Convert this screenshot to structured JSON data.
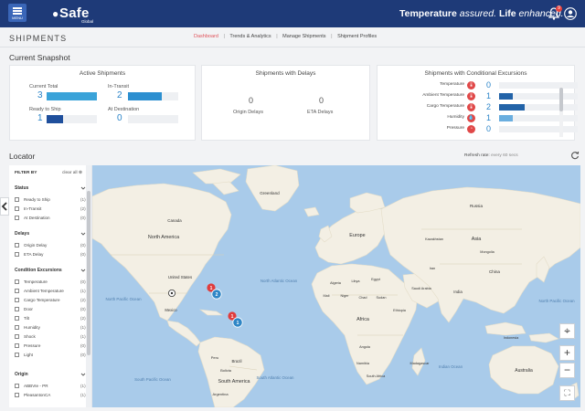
{
  "header": {
    "menu_label": "MENU",
    "logo_text": "Safe",
    "logo_sub": "Global",
    "tagline_strong_1": "Temperature",
    "tagline_italic_1": "assured.",
    "tagline_strong_2": "Life",
    "tagline_italic_2": "enhanced.",
    "notification_count": "9",
    "icons": [
      "menu-icon",
      "bell-icon",
      "user-icon"
    ]
  },
  "page": {
    "title": "SHIPMENTS",
    "nav": [
      "Dashboard",
      "Trends & Analytics",
      "Manage Shipments",
      "Shipment Profiles"
    ],
    "nav_active": "Dashboard"
  },
  "snapshot": {
    "title": "Current Snapshot",
    "active": {
      "title": "Active Shipments",
      "tiles": [
        {
          "label": "Current Total",
          "value": "3",
          "fill": 1.0,
          "color": "#3aa3d9"
        },
        {
          "label": "In-Transit",
          "value": "2",
          "fill": 0.67,
          "color": "#2c8fd0"
        },
        {
          "label": "Ready to Ship",
          "value": "1",
          "fill": 0.33,
          "color": "#1f4f9c"
        },
        {
          "label": "At Destination",
          "value": "0",
          "fill": 0.0,
          "color": "#2c8fd0"
        }
      ]
    },
    "delays": {
      "title": "Shipments with Delays",
      "items": [
        {
          "label": "Origin Delays",
          "value": "0"
        },
        {
          "label": "ETA Delays",
          "value": "0"
        }
      ]
    },
    "excursions": {
      "title": "Shipments with Conditional Excursions",
      "rows": [
        {
          "label": "Temperature",
          "value": "0",
          "icon": "thermometer-icon",
          "fill": 0.0,
          "color": "#2c8fd0"
        },
        {
          "label": "Ambient Temperature",
          "value": "1",
          "icon": "thermometer-icon",
          "fill": 0.17,
          "color": "#2263a8"
        },
        {
          "label": "Cargo Temperature",
          "value": "2",
          "icon": "thermometer-icon",
          "fill": 0.33,
          "color": "#2263a8"
        },
        {
          "label": "Humidity",
          "value": "1",
          "icon": "droplet-icon",
          "fill": 0.17,
          "color": "#6aaedf"
        },
        {
          "label": "Pressure",
          "value": "0",
          "icon": "gauge-icon",
          "fill": 0.0,
          "color": "#2c8fd0"
        }
      ]
    }
  },
  "locator": {
    "title": "Locator",
    "refresh_label": "Refresh rate:",
    "refresh_value": "every 60 secs",
    "filter": {
      "title": "FILTER BY",
      "clear_label": "clear all",
      "groups": [
        {
          "title": "Status",
          "options": [
            {
              "label": "Ready to Ship",
              "count": "(1)"
            },
            {
              "label": "In-Transit",
              "count": "(2)"
            },
            {
              "label": "At Destination",
              "count": "(0)"
            }
          ]
        },
        {
          "title": "Delays",
          "options": [
            {
              "label": "Origin Delay",
              "count": "(0)"
            },
            {
              "label": "ETA Delay",
              "count": "(0)"
            }
          ]
        },
        {
          "title": "Condition Excursions",
          "options": [
            {
              "label": "Temperature",
              "count": "(0)"
            },
            {
              "label": "Ambient Temperature",
              "count": "(1)"
            },
            {
              "label": "Cargo Temperature",
              "count": "(2)"
            },
            {
              "label": "Door",
              "count": "(0)"
            },
            {
              "label": "Tilt",
              "count": "(2)"
            },
            {
              "label": "Humidity",
              "count": "(1)"
            },
            {
              "label": "Shock",
              "count": "(1)"
            },
            {
              "label": "Pressure",
              "count": "(0)"
            },
            {
              "label": "Light",
              "count": "(0)"
            }
          ]
        },
        {
          "title": "Origin",
          "options": [
            {
              "label": "ABBVIe - PR",
              "count": "(1)"
            },
            {
              "label": "PleasantonCA",
              "count": "(1)"
            }
          ]
        }
      ]
    },
    "map": {
      "labels": {
        "greenland": "Greenland",
        "north_america": "North America",
        "south_america": "South America",
        "europe": "Europe",
        "africa": "Africa",
        "asia": "Asia",
        "australia": "Australia",
        "n_pacific": "North Pacific Ocean",
        "n_pacific_right": "North Pacific Ocean",
        "n_atlantic": "North Atlantic Ocean",
        "s_atlantic": "South Atlantic Ocean",
        "s_pacific": "South Pacific Ocean",
        "indian": "Indian Ocean",
        "united_states": "United States",
        "brazil": "Brazil",
        "russia": "Russia",
        "china": "China",
        "india": "India",
        "mexico": "Mexico",
        "canada": "Canada",
        "algeria": "Algeria",
        "libya": "Libya",
        "egypt": "Egypt",
        "chad": "Chad",
        "sudan": "Sudan",
        "niger": "Niger",
        "mali": "Mali",
        "saudi": "Saudi Arabia",
        "iran": "Iran",
        "ethiopia": "Ethiopia",
        "kazakhstan": "Kazakhstan",
        "mongolia": "Mongolia",
        "angola": "Angola",
        "peru": "Peru",
        "bolivia": "Bolivia",
        "argentina": "Argentina",
        "indonesia": "Indonesia",
        "madagascar": "Madagascar",
        "namibia": "Namibia",
        "south_africa": "South Africa"
      },
      "markers": [
        {
          "type": "origin",
          "count": ""
        },
        {
          "type": "alert",
          "count": "1"
        },
        {
          "type": "cluster",
          "count": "2"
        },
        {
          "type": "alert",
          "count": "1"
        },
        {
          "type": "cluster",
          "count": "1"
        }
      ],
      "controls": [
        "locate-icon",
        "zoom-in-icon",
        "zoom-out-icon",
        "fullscreen-icon"
      ]
    }
  }
}
